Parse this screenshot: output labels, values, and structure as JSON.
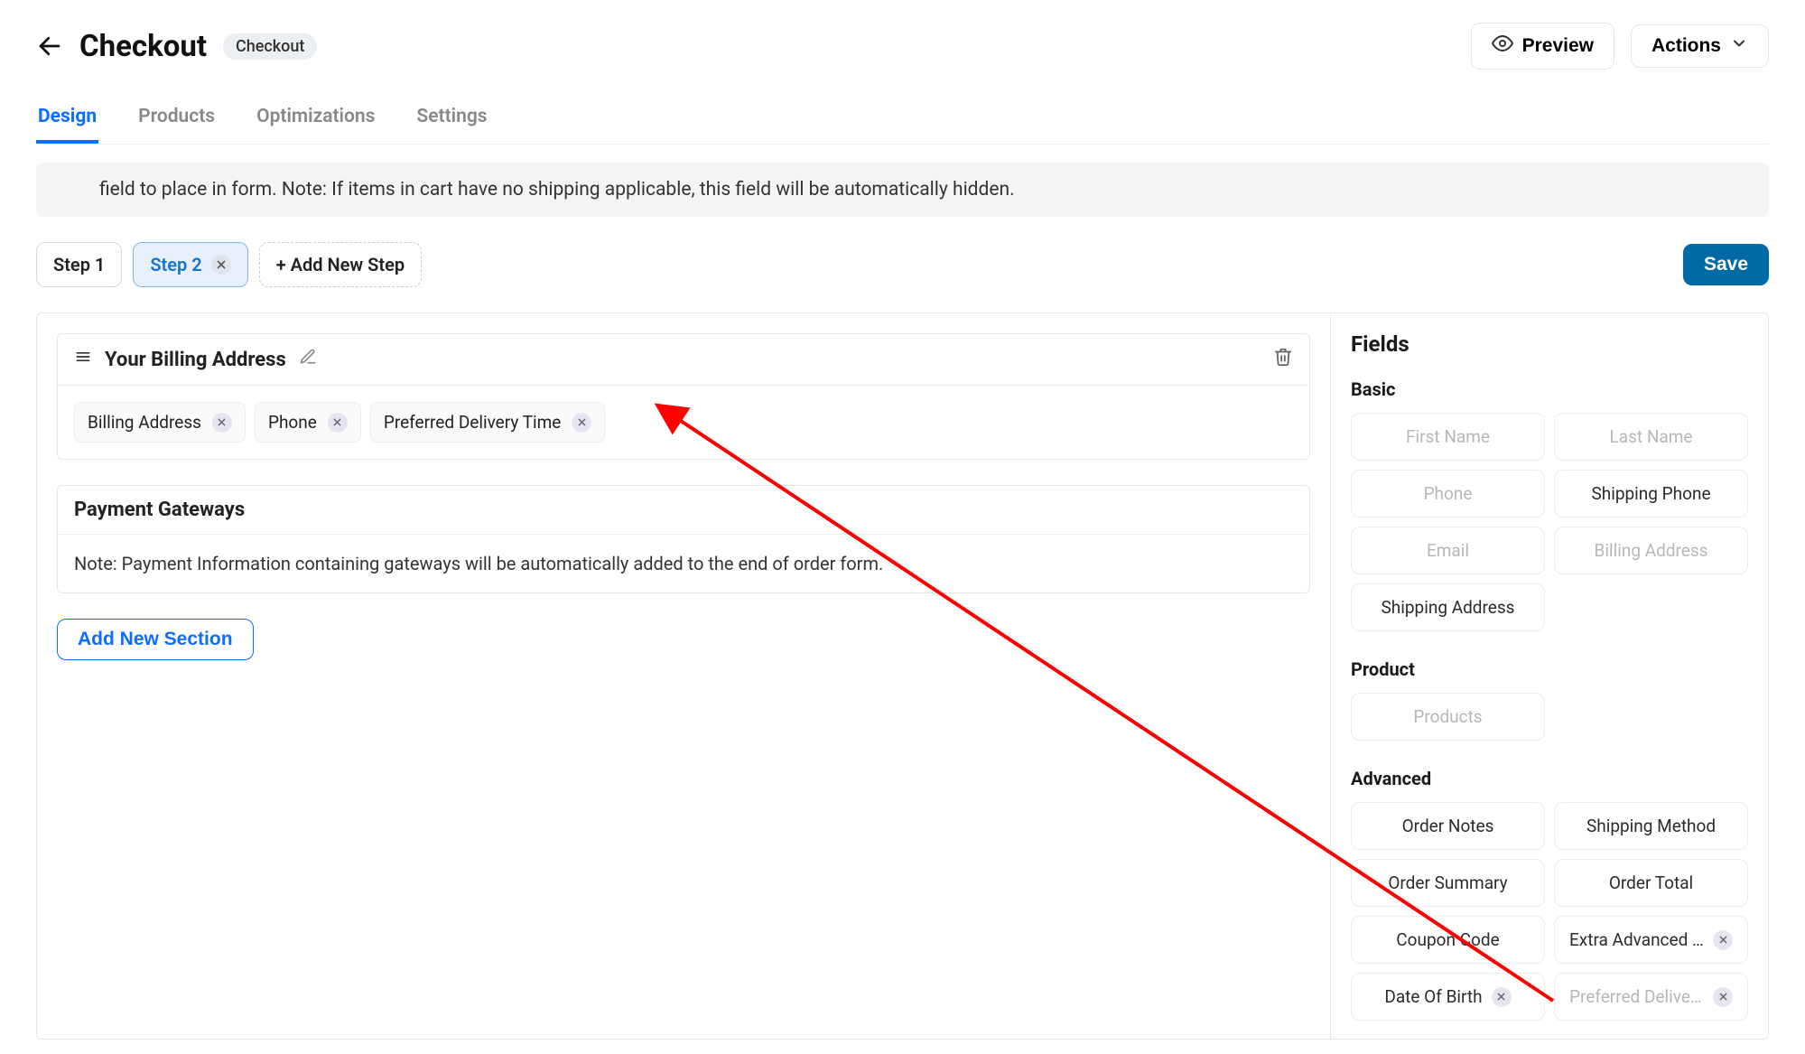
{
  "header": {
    "title": "Checkout",
    "badge": "Checkout",
    "preview_label": "Preview",
    "actions_label": "Actions"
  },
  "tabs": [
    {
      "label": "Design",
      "active": true
    },
    {
      "label": "Products",
      "active": false
    },
    {
      "label": "Optimizations",
      "active": false
    },
    {
      "label": "Settings",
      "active": false
    }
  ],
  "notice": "field to place in form. Note: If items in cart have no shipping applicable, this field will be automatically hidden.",
  "steps": {
    "items": [
      {
        "label": "Step 1",
        "active": false,
        "closable": false
      },
      {
        "label": "Step 2",
        "active": true,
        "closable": true
      }
    ],
    "add_label": "+ Add New Step",
    "save_label": "Save"
  },
  "sections": [
    {
      "title": "Your Billing Address",
      "editable": true,
      "chips": [
        {
          "label": "Billing Address"
        },
        {
          "label": "Phone"
        },
        {
          "label": "Preferred Delivery Time"
        }
      ]
    }
  ],
  "payment_section": {
    "title": "Payment Gateways",
    "note": "Note: Payment Information containing gateways will be automatically added to the end of order form."
  },
  "add_section_label": "Add New Section",
  "sidebar": {
    "title": "Fields",
    "groups": [
      {
        "title": "Basic",
        "fields": [
          {
            "label": "First Name",
            "disabled": true,
            "removable": false
          },
          {
            "label": "Last Name",
            "disabled": true,
            "removable": false
          },
          {
            "label": "Phone",
            "disabled": true,
            "removable": false
          },
          {
            "label": "Shipping Phone",
            "disabled": false,
            "removable": false
          },
          {
            "label": "Email",
            "disabled": true,
            "removable": false
          },
          {
            "label": "Billing Address",
            "disabled": true,
            "removable": false
          },
          {
            "label": "Shipping Address",
            "disabled": false,
            "removable": false
          }
        ]
      },
      {
        "title": "Product",
        "fields": [
          {
            "label": "Products",
            "disabled": true,
            "removable": false
          }
        ]
      },
      {
        "title": "Advanced",
        "fields": [
          {
            "label": "Order Notes",
            "disabled": false,
            "removable": false
          },
          {
            "label": "Shipping Method",
            "disabled": false,
            "removable": false
          },
          {
            "label": "Order Summary",
            "disabled": false,
            "removable": false
          },
          {
            "label": "Order Total",
            "disabled": false,
            "removable": false
          },
          {
            "label": "Coupon Code",
            "disabled": false,
            "removable": false
          },
          {
            "label": "Extra Advanced Field",
            "disabled": false,
            "removable": true
          },
          {
            "label": "Date Of Birth",
            "disabled": false,
            "removable": true
          },
          {
            "label": "Preferred Delivery Ti...",
            "disabled": true,
            "removable": true
          }
        ]
      }
    ]
  }
}
